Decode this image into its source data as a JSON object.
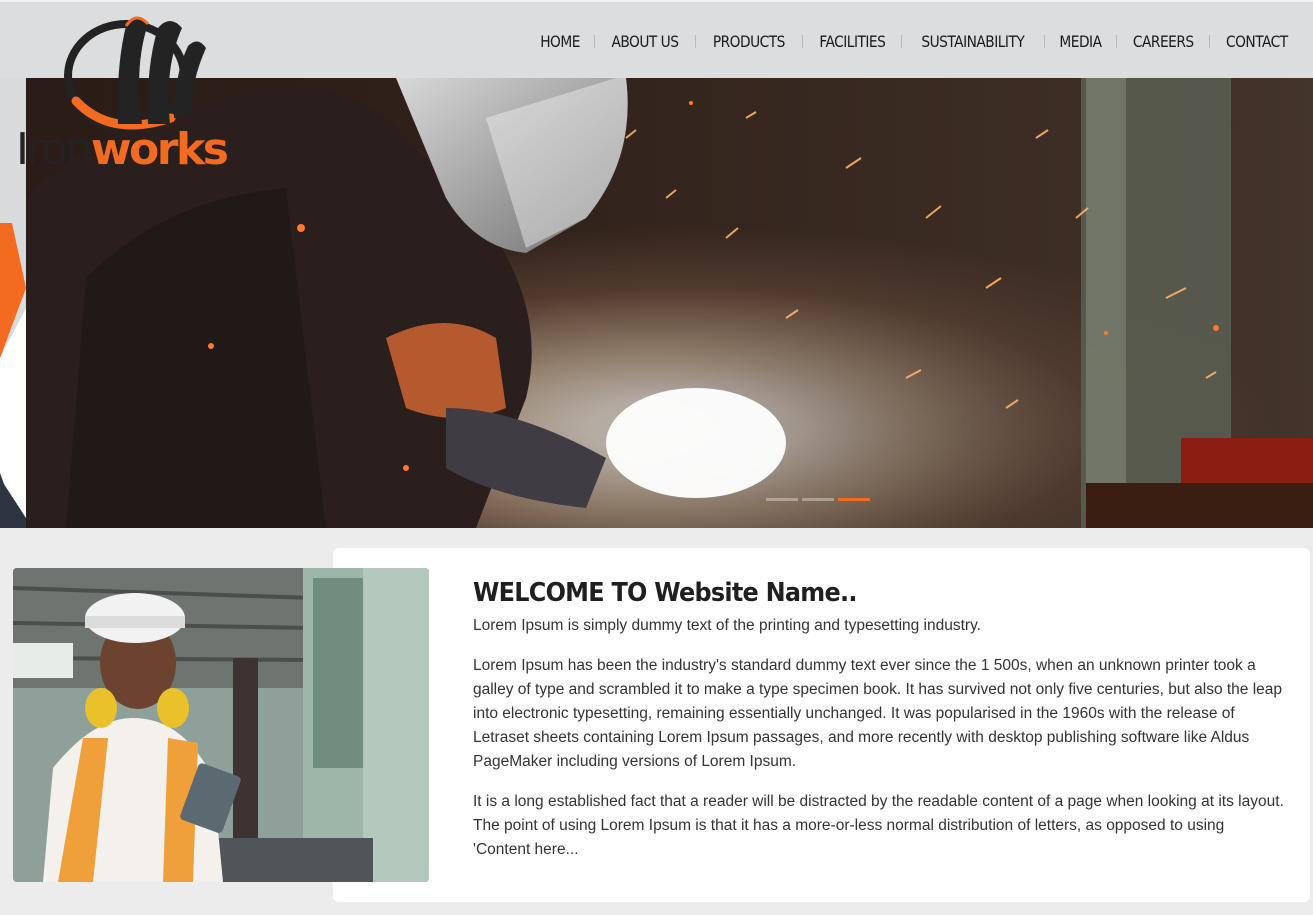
{
  "brand": {
    "name_part1": "Iron",
    "name_part2": "works",
    "accent": "#f26b21",
    "dark": "#232323"
  },
  "nav": {
    "items": [
      "HOME",
      "ABOUT US",
      "PRODUCTS",
      "FACILITIES",
      "SUSTAINABILITY",
      "MEDIA",
      "CAREERS",
      "CONTACT"
    ]
  },
  "hero": {
    "slide_count": 3,
    "active_slide": 3
  },
  "welcome": {
    "title": "WELCOME TO Website Name..",
    "intro": "Lorem Ipsum is simply dummy text of the printing and typesetting industry.",
    "paragraph1": "Lorem Ipsum has been the industry's standard dummy text ever since the 1 500s, when an unknown printer took a galley of type and scrambled it to make a type specimen book. It has survived not only five centuries, but also the leap into electronic typesetting, remaining essentially unchanged. It was popularised in the 1960s with the release of Letraset sheets containing Lorem Ipsum passages, and more recently with desktop publishing software like Aldus PageMaker including versions of Lorem Ipsum.",
    "paragraph2": "It is a long established fact that a reader will be distracted by the readable content of a page when looking at its layout. The point of using Lorem Ipsum is that it has a more-or-less normal distribution of letters, as opposed to using 'Content here..."
  }
}
